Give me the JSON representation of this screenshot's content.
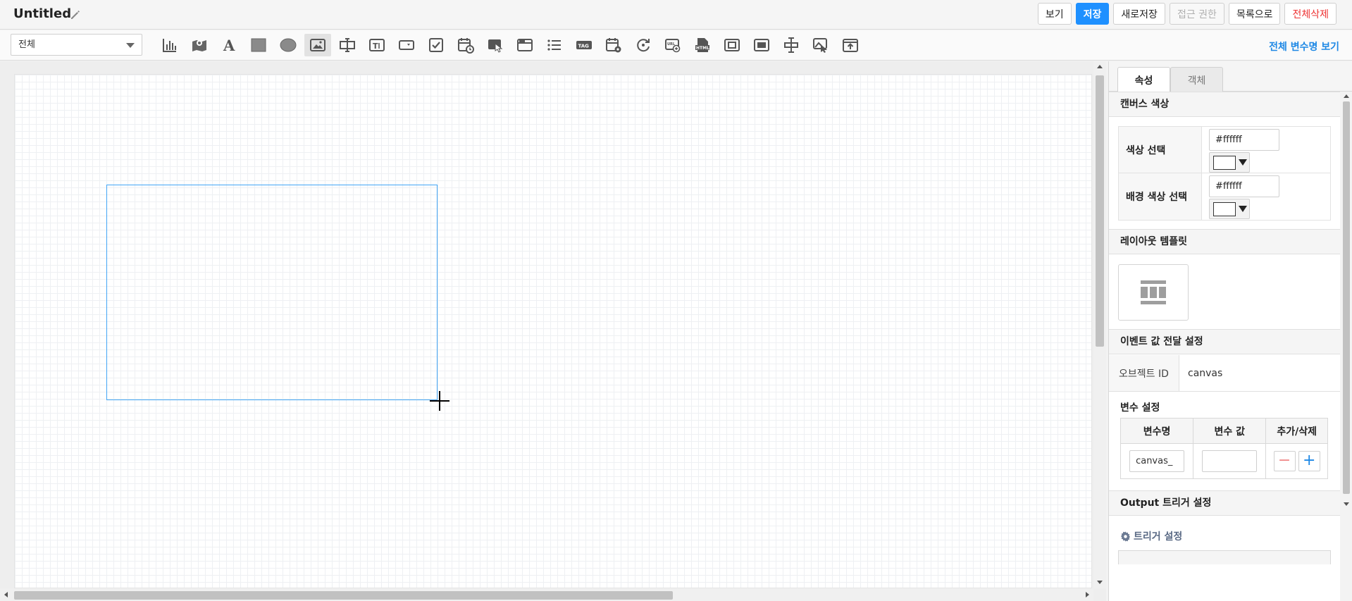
{
  "header": {
    "title": "Untitled",
    "buttons": {
      "view": "보기",
      "save": "저장",
      "save_as": "새로저장",
      "access": "접근 권한",
      "to_list": "목록으로",
      "delete_all": "전체삭제"
    },
    "colors": {
      "primary": "#1e90ff",
      "danger": "#ee3333"
    }
  },
  "toolbar": {
    "filter_value": "전체",
    "view_all_vars": "전체 변수명 보기",
    "tools": [
      "bar-chart-icon",
      "map-icon",
      "text-icon",
      "rectangle-icon",
      "ellipse-icon",
      "image-icon",
      "text-input-icon",
      "textbox-icon",
      "dropdown-icon",
      "checkbox-icon",
      "date-icon",
      "hand-click-icon",
      "window-icon",
      "list-icon",
      "tag-icon",
      "calendar-settings-icon",
      "refresh-icon",
      "link-icon",
      "html-icon",
      "frame-icon",
      "panel-icon",
      "cursor-text-icon",
      "image-click-icon",
      "upload-icon"
    ],
    "active_tool": "image-icon"
  },
  "panel": {
    "tabs": {
      "properties": "속성",
      "objects": "객체"
    },
    "canvas_color": {
      "title": "캔버스 색상",
      "color_label": "색상 선택",
      "color_value": "#ffffff",
      "bg_label": "배경 색상 선택",
      "bg_value": "#ffffff"
    },
    "layout_template": {
      "title": "레이아웃 템플릿"
    },
    "event": {
      "title": "이벤트 값 전달 설정",
      "object_id_label": "오브젝트 ID",
      "object_id_value": "canvas"
    },
    "variables": {
      "title": "변수 설정",
      "headers": [
        "변수명",
        "변수 값",
        "추가/삭제"
      ],
      "row": {
        "name": "canvas_",
        "value": ""
      }
    },
    "output": {
      "title": "Output 트리거 설정",
      "trigger_link": "트리거 설정"
    }
  }
}
